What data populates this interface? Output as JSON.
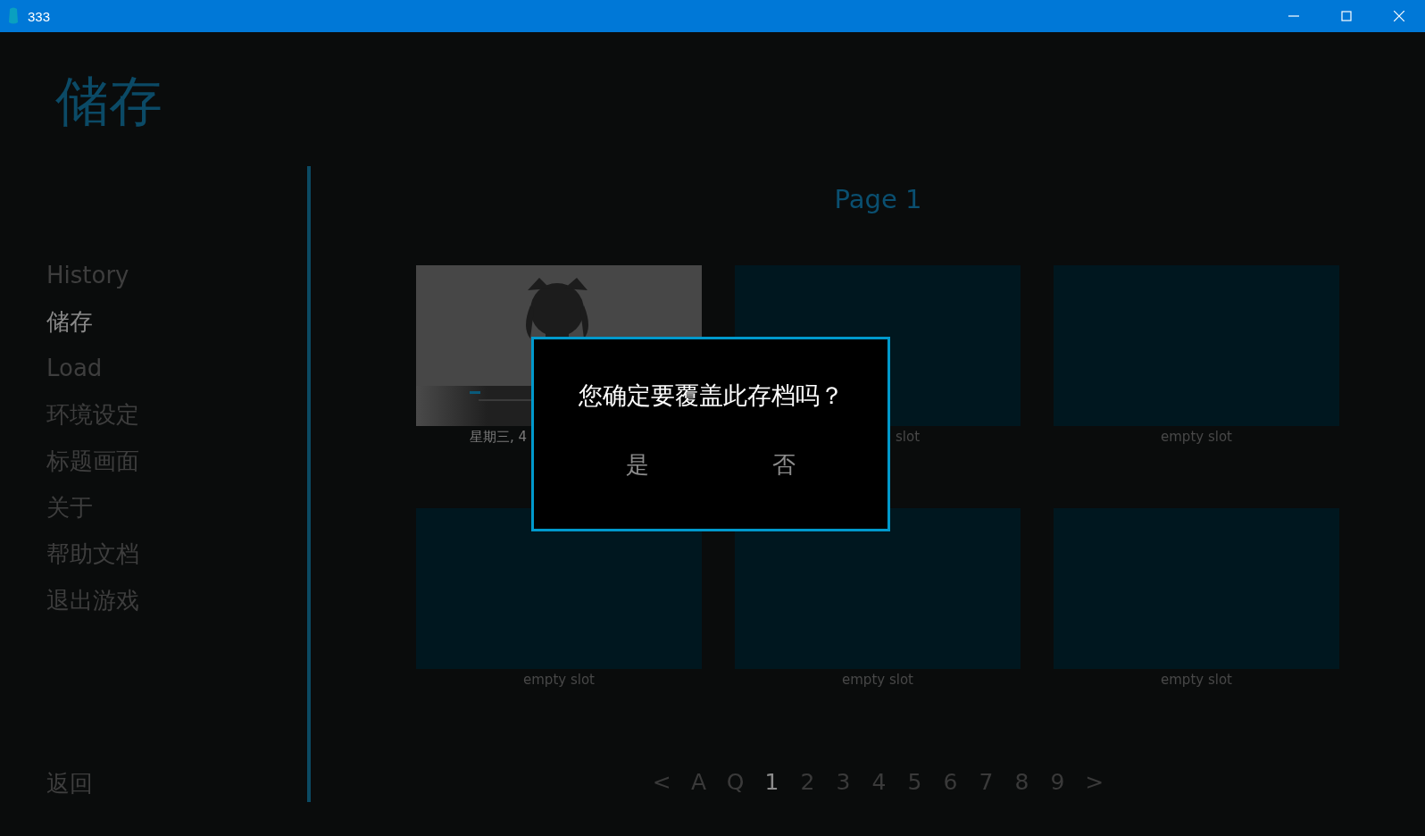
{
  "window": {
    "title": "333"
  },
  "screen_title": "储存",
  "nav": [
    {
      "label": "History",
      "selected": false
    },
    {
      "label": "储存",
      "selected": true
    },
    {
      "label": "Load",
      "selected": false
    },
    {
      "label": "环境设定",
      "selected": false
    },
    {
      "label": "标题画面",
      "selected": false
    },
    {
      "label": "关于",
      "selected": false
    },
    {
      "label": "帮助文档",
      "selected": false
    },
    {
      "label": "退出游戏",
      "selected": false
    }
  ],
  "return_button": "返回",
  "page_title": "Page 1",
  "slots": [
    {
      "kind": "picture",
      "label": "星期三, 4",
      "clipped_right": true
    },
    {
      "kind": "empty",
      "label": "slot",
      "clipped_left": true
    },
    {
      "kind": "empty",
      "label": "empty slot"
    },
    {
      "kind": "empty",
      "label": "empty slot"
    },
    {
      "kind": "empty",
      "label": "empty slot"
    },
    {
      "kind": "empty",
      "label": "empty slot"
    }
  ],
  "pager": [
    {
      "label": "<",
      "selected": false
    },
    {
      "label": "A",
      "selected": false
    },
    {
      "label": "Q",
      "selected": false
    },
    {
      "label": "1",
      "selected": true
    },
    {
      "label": "2",
      "selected": false
    },
    {
      "label": "3",
      "selected": false
    },
    {
      "label": "4",
      "selected": false
    },
    {
      "label": "5",
      "selected": false
    },
    {
      "label": "6",
      "selected": false
    },
    {
      "label": "7",
      "selected": false
    },
    {
      "label": "8",
      "selected": false
    },
    {
      "label": "9",
      "selected": false
    },
    {
      "label": ">",
      "selected": false
    }
  ],
  "dialog": {
    "message": "您确定要覆盖此存档吗？",
    "buttons": [
      "是",
      "否"
    ]
  }
}
